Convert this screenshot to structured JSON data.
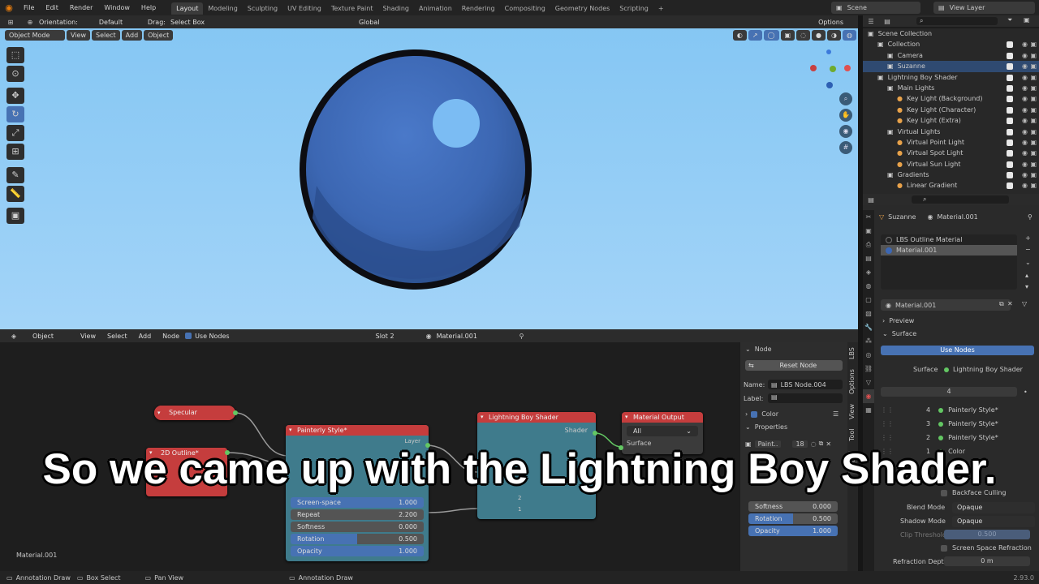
{
  "topbar": {
    "menus": [
      "File",
      "Edit",
      "Render",
      "Window",
      "Help"
    ],
    "workspaces": [
      "Layout",
      "Modeling",
      "Sculpting",
      "UV Editing",
      "Texture Paint",
      "Shading",
      "Animation",
      "Rendering",
      "Compositing",
      "Geometry Nodes",
      "Scripting"
    ],
    "active_workspace": "Layout",
    "scene": "Scene",
    "view_layer": "View Layer"
  },
  "viewport_header": {
    "orientation_label": "Orientation:",
    "orientation_value": "Default",
    "drag_label": "Drag:",
    "drag_value": "Select Box",
    "transform": "Global",
    "options": "Options",
    "mode": "Object Mode",
    "menus": [
      "View",
      "Select",
      "Add",
      "Object"
    ]
  },
  "outliner": {
    "rows": [
      {
        "label": "Scene Collection",
        "indent": 0
      },
      {
        "label": "Collection",
        "indent": 1
      },
      {
        "label": "Camera",
        "indent": 2
      },
      {
        "label": "Suzanne",
        "indent": 2,
        "selected": true
      },
      {
        "label": "Lightning Boy Shader",
        "indent": 1
      },
      {
        "label": "Main Lights",
        "indent": 2
      },
      {
        "label": "Key Light (Background)",
        "indent": 3
      },
      {
        "label": "Key Light (Character)",
        "indent": 3
      },
      {
        "label": "Key Light (Extra)",
        "indent": 3
      },
      {
        "label": "Virtual Lights",
        "indent": 2
      },
      {
        "label": "Virtual Point Light",
        "indent": 3
      },
      {
        "label": "Virtual Spot Light",
        "indent": 3
      },
      {
        "label": "Virtual Sun Light",
        "indent": 3
      },
      {
        "label": "Gradients",
        "indent": 2
      },
      {
        "label": "Linear Gradient",
        "indent": 3
      }
    ]
  },
  "properties": {
    "object": "Suzanne",
    "material_tab": "Material.001",
    "slots": [
      "LBS Outline Material",
      "Material.001"
    ],
    "material_name": "Material.001",
    "preview": "Preview",
    "surface": "Surface",
    "use_nodes": "Use Nodes",
    "surface_label": "Surface",
    "surface_value": "Lightning Boy Shader",
    "layer_count": "4",
    "layers": [
      {
        "num": "4",
        "label": "Painterly Style*"
      },
      {
        "num": "3",
        "label": "Painterly Style*"
      },
      {
        "num": "2",
        "label": "Painterly Style*"
      },
      {
        "num": "1",
        "label": "Color"
      }
    ],
    "backface": "Backface Culling",
    "blend_label": "Blend Mode",
    "blend_value": "Opaque",
    "shadow_label": "Shadow Mode",
    "shadow_value": "Opaque",
    "clip_label": "Clip Threshold",
    "clip_value": "0.500",
    "ssr": "Screen Space Refraction",
    "refr_label": "Refraction Depth",
    "refr_value": "0 m"
  },
  "node_header": {
    "editor": "Object",
    "menus": [
      "View",
      "Select",
      "Add",
      "Node"
    ],
    "use_nodes": "Use Nodes",
    "slot": "Slot 2",
    "material": "Material.001"
  },
  "nodes": {
    "specular": "Specular",
    "outline": "2D Outline*",
    "painterly": "Painterly Style*",
    "painterly_layer": "Layer",
    "painterly_fields": [
      {
        "label": "Screen-space",
        "value": "1.000",
        "fill": 1.0
      },
      {
        "label": "Repeat",
        "value": "2.200",
        "fill": 0
      },
      {
        "label": "Softness",
        "value": "0.000",
        "fill": 0
      },
      {
        "label": "Rotation",
        "value": "0.500",
        "fill": 0.5
      },
      {
        "label": "Opacity",
        "value": "1.000",
        "fill": 1.0
      }
    ],
    "lbs": "Lightning Boy Shader",
    "lbs_shader": "Shader",
    "lbs_rows": [
      "2",
      "1"
    ],
    "output": "Material Output",
    "output_target": "All",
    "output_surface": "Surface",
    "frame_label": "Material.001"
  },
  "npanel": {
    "node_section": "Node",
    "reset": "Reset Node",
    "name_label": "Name:",
    "name_value": "LBS Node.004",
    "label_label": "Label:",
    "color": "Color",
    "properties": "Properties",
    "paint": "Paint..",
    "paint_users": "18",
    "fields": [
      {
        "label": "Softness",
        "value": "0.000",
        "fill": 0
      },
      {
        "label": "Rotation",
        "value": "0.500",
        "fill": 0.5
      },
      {
        "label": "Opacity",
        "value": "1.000",
        "fill": 1.0
      }
    ],
    "tabs": [
      "Node",
      "Tool",
      "View",
      "Options",
      "LBS"
    ]
  },
  "status": {
    "items": [
      "Annotation Draw",
      "Box Select",
      "Pan View",
      "Annotation Draw"
    ],
    "version": "2.93.0"
  },
  "subtitle": "So we came up with the Lightning Boy Shader.",
  "colors": {
    "accent": "#4772b3",
    "node_header_red": "#c53d3d",
    "socket_green": "#63c763",
    "viewport_sky": "#84c6f3"
  }
}
